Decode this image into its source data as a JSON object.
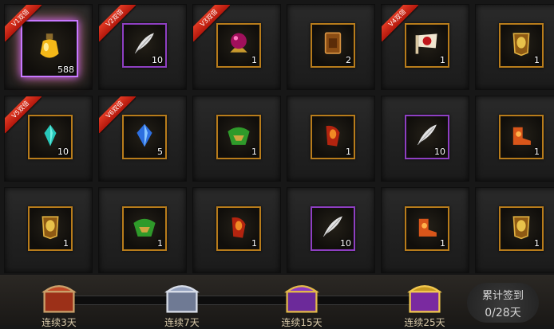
{
  "grid": {
    "rows": [
      [
        {
          "icon": "golden-potion-icon",
          "qty": "588",
          "badge": "V1双倍",
          "frame": "glow"
        },
        {
          "icon": "white-feather-icon",
          "qty": "10",
          "badge": "V2双倍",
          "frame": "purple"
        },
        {
          "icon": "purple-crystal-orb-icon",
          "qty": "1",
          "badge": "V3双倍",
          "frame": "gold"
        },
        {
          "icon": "bronze-token-icon",
          "qty": "2",
          "badge": "",
          "frame": "gold"
        },
        {
          "icon": "red-flag-scroll-icon",
          "qty": "1",
          "badge": "V4双倍",
          "frame": "gold"
        },
        {
          "icon": "golden-armor-icon",
          "qty": "1",
          "badge": "",
          "frame": "gold"
        }
      ],
      [
        {
          "icon": "cyan-gem-icon",
          "qty": "10",
          "badge": "V5双倍",
          "frame": "gold"
        },
        {
          "icon": "blue-gem-icon",
          "qty": "5",
          "badge": "V6双倍",
          "frame": "gold"
        },
        {
          "icon": "green-helmet-icon",
          "qty": "1",
          "badge": "",
          "frame": "gold"
        },
        {
          "icon": "red-bracer-icon",
          "qty": "1",
          "badge": "",
          "frame": "gold"
        },
        {
          "icon": "white-feather-icon",
          "qty": "10",
          "badge": "",
          "frame": "purple"
        },
        {
          "icon": "orange-boots-icon",
          "qty": "1",
          "badge": "",
          "frame": "gold"
        }
      ],
      [
        {
          "icon": "golden-armor-icon",
          "qty": "1",
          "badge": "",
          "frame": "gold"
        },
        {
          "icon": "green-helmet-icon",
          "qty": "1",
          "badge": "",
          "frame": "gold"
        },
        {
          "icon": "red-bracer-icon",
          "qty": "1",
          "badge": "",
          "frame": "gold"
        },
        {
          "icon": "white-feather-icon",
          "qty": "10",
          "badge": "",
          "frame": "purple"
        },
        {
          "icon": "orange-boots-icon",
          "qty": "1",
          "badge": "",
          "frame": "gold"
        },
        {
          "icon": "golden-armor-icon",
          "qty": "1",
          "badge": "",
          "frame": "gold"
        }
      ]
    ]
  },
  "rewards": {
    "chests": [
      {
        "icon": "red-chest-icon",
        "label": "连续3天"
      },
      {
        "icon": "silver-chest-icon",
        "label": "连续7天"
      },
      {
        "icon": "purple-chest-icon",
        "label": "连续15天"
      },
      {
        "icon": "golden-chest-icon",
        "label": "连续25天"
      }
    ]
  },
  "signin": {
    "title": "累计签到",
    "count": "0/28天"
  },
  "colors": {
    "slot_gold": "#b87c1b",
    "slot_purple": "#8e3fc2",
    "ribbon": "#d42a18"
  }
}
